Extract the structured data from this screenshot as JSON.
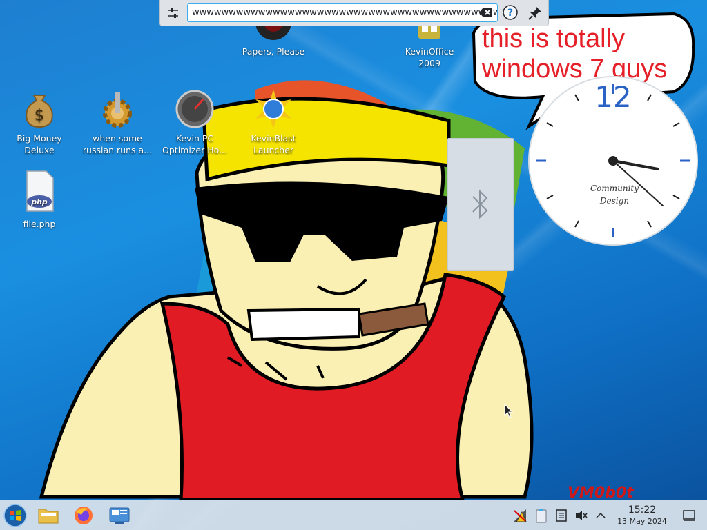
{
  "desktop": {
    "icons": [
      {
        "label": "Papers, Please",
        "icon": "papers-please-icon"
      },
      {
        "label": "KevinOffice 2009",
        "icon": "kevinoffice-icon"
      },
      {
        "label": "Big Money Deluxe",
        "icon": "money-bag-icon"
      },
      {
        "label": "when some russian runs a...",
        "icon": "gear-icon"
      },
      {
        "label": "Kevin PC Optimizer Ho...",
        "icon": "speedometer-icon"
      },
      {
        "label": "KevinBlast Launcher",
        "icon": "globe-burst-icon"
      },
      {
        "label": "file.php",
        "icon": "php-file-icon"
      }
    ],
    "meme_caption": "this is totally windows 7 guys",
    "watermark": "VM0b0t"
  },
  "krunner": {
    "query": "wwwwwwwwwwwwwwwwwwwwwwwwwwwwwwwwwwwwwwwwwwwwwwwwwwwwwwwww",
    "config_icon": "settings-sliders-icon",
    "clear_icon": "clear-text-icon",
    "help_icon": "help-icon",
    "pin_icon": "pin-icon"
  },
  "bluetooth_popup": {
    "icon": "bluetooth-icon"
  },
  "clock_widget": {
    "twelve": "12",
    "brand_line1": "Community",
    "brand_line2": "Design",
    "time": "15:22"
  },
  "taskbar": {
    "launchers": [
      "start-orb-icon",
      "file-manager-icon",
      "firefox-icon",
      "system-settings-icon"
    ],
    "tray": [
      "network-warning-icon",
      "clipboard-icon",
      "notes-icon",
      "volume-muted-icon",
      "expand-tray-icon"
    ],
    "time": "15:22",
    "date": "13 May 2024",
    "show_desktop_icon": "show-desktop-icon"
  },
  "colors": {
    "desktop_blue": "#1a8fe0",
    "caption_red": "#e62028",
    "clock_blue": "#2a62c6",
    "shirt_red": "#e01b24",
    "skin": "#fbf0b4",
    "hat_yellow": "#f5e400"
  }
}
